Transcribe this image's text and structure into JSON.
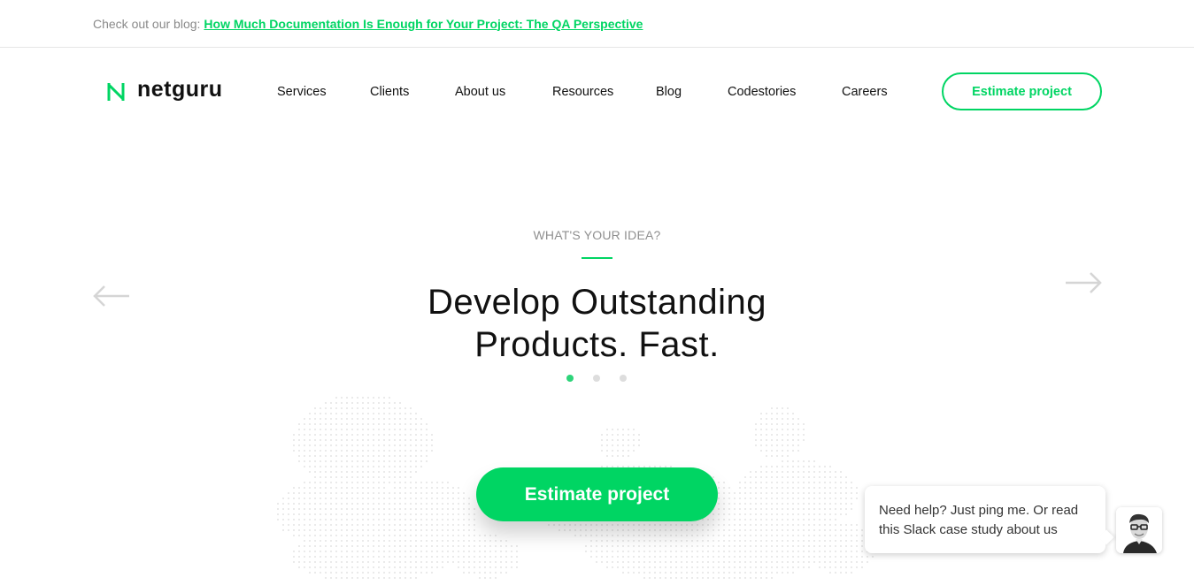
{
  "topbar": {
    "lead": "Check out our blog:",
    "link": "How Much Documentation Is Enough for Your Project: The QA Perspective"
  },
  "brand": {
    "name": "netguru",
    "accent": "#00d563"
  },
  "nav": {
    "items": [
      {
        "label": "Services"
      },
      {
        "label": "Clients"
      },
      {
        "label": "About us"
      },
      {
        "label": "Resources"
      },
      {
        "label": "Blog"
      },
      {
        "label": "Codestories"
      },
      {
        "label": "Careers"
      }
    ],
    "cta": "Estimate project"
  },
  "hero": {
    "eyebrow": "WHAT'S YOUR IDEA?",
    "headline_line1": "Develop Outstanding",
    "headline_line2": "Products. Fast.",
    "slider": {
      "total_slides": 3,
      "active_slide": 1
    },
    "cta": "Estimate project",
    "prev_icon": "arrow-left-icon",
    "next_icon": "arrow-right-icon"
  },
  "chat": {
    "message": "Need help? Just ping me. Or read this Slack case study about us",
    "avatar_icon": "person-avatar"
  }
}
